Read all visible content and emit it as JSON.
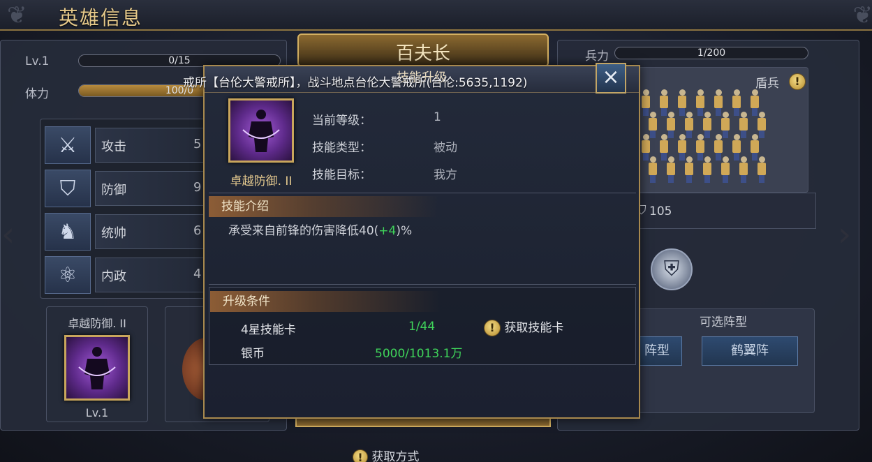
{
  "header": {
    "title": "英雄信息"
  },
  "hero": {
    "level_label": "Lv.1",
    "exp_text": "0/15",
    "stamina_label": "体力",
    "stamina_text": "100/0",
    "stamina_fill": 1.0,
    "stats": [
      {
        "icon": "crossed-swords-icon",
        "name": "攻击",
        "value": "5"
      },
      {
        "icon": "shield-icon",
        "name": "防御",
        "value": "9"
      },
      {
        "icon": "horse-icon",
        "name": "统帅",
        "value": "6"
      },
      {
        "icon": "atom-icon",
        "name": "内政",
        "value": "4"
      }
    ],
    "skill_card": {
      "name": "卓越防御. II",
      "level": "Lv.1"
    }
  },
  "rank": {
    "title": "百夫长",
    "subtitle": "技能升级"
  },
  "troops": {
    "label": "兵力",
    "count_text": "1/200",
    "type": "盾兵",
    "power": "105",
    "formation_title": "可选阵型",
    "formations": [
      "阵型",
      "鹤翼阵"
    ]
  },
  "ticker": "戒所【台伦大警戒所】，战斗地点台伦大警戒所(台伦:5635,1192)",
  "bottom_hint": "获取方式",
  "modal": {
    "skill_name": "卓越防御. II",
    "rows": [
      {
        "label": "当前等级：",
        "value": "1"
      },
      {
        "label": "技能类型：",
        "value": "被动"
      },
      {
        "label": "技能目标：",
        "value": "我方"
      }
    ],
    "intro_title": "技能介绍",
    "intro_prefix": "承受来自前锋的伤害降低40(",
    "intro_bonus": "+4",
    "intro_suffix": ")%",
    "upgrade_title": "升级条件",
    "requirements": [
      {
        "name": "4星技能卡",
        "progress": "1/44",
        "action": "获取技能卡"
      },
      {
        "name": "银币",
        "progress": "5000/1013.1万"
      }
    ],
    "close_label": "×"
  },
  "colors": {
    "gold": "#c9a65c",
    "green": "#3fd35a",
    "panel": "#262b3a"
  }
}
